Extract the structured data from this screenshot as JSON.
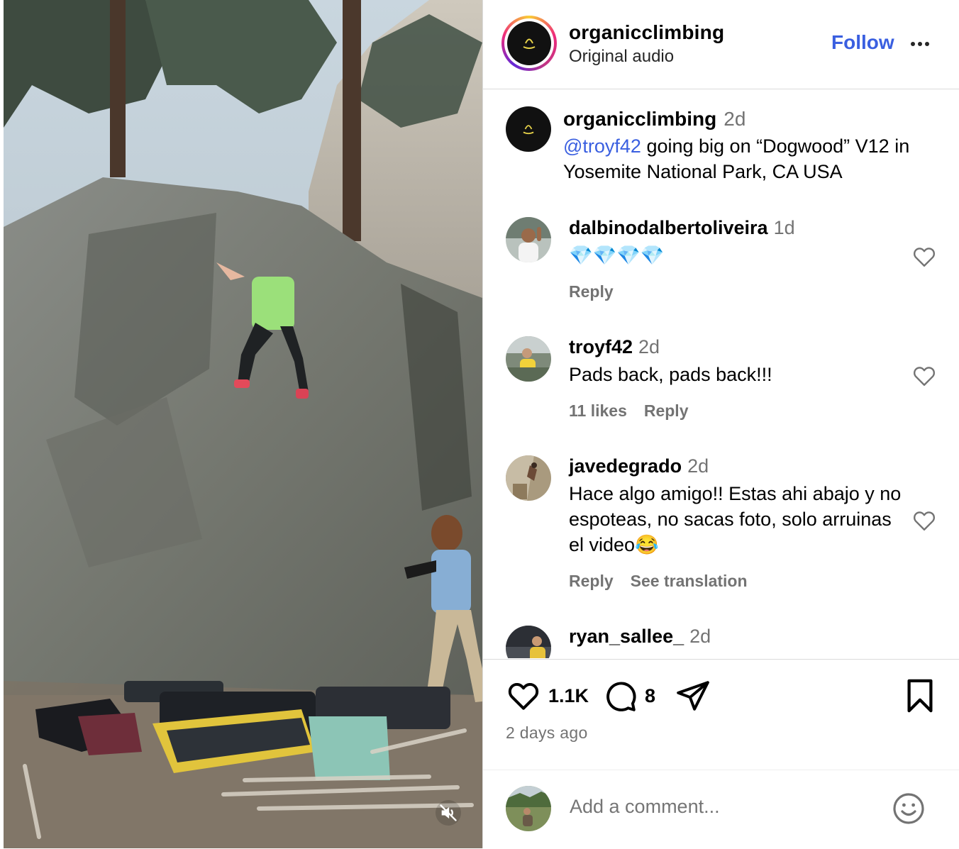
{
  "post": {
    "username": "organicclimbing",
    "audio": "Original audio",
    "follow_label": "Follow",
    "caption": {
      "username": "organicclimbing",
      "time": "2d",
      "mention": "@troyf42",
      "text": " going big on “Dogwood” V12 in Yosemite National Park, CA USA"
    }
  },
  "comments": [
    {
      "username": "dalbinodalbertoliveira",
      "time": "1d",
      "text": "💎💎💎💎",
      "likes": "",
      "reply": "Reply",
      "translation": ""
    },
    {
      "username": "troyf42",
      "time": "2d",
      "text": "Pads back, pads back!!!",
      "likes": "11 likes",
      "reply": "Reply",
      "translation": ""
    },
    {
      "username": "javedegrado",
      "time": "2d",
      "text": "Hace algo amigo!! Estas ahi abajo y no espoteas, no sacas foto, solo arruinas el video😂",
      "likes": "",
      "reply": "Reply",
      "translation": "See translation"
    },
    {
      "username": "ryan_sallee_",
      "time": "2d",
      "text": "",
      "likes": "",
      "reply": "",
      "translation": ""
    }
  ],
  "actions": {
    "likes_count": "1.1K",
    "comments_count": "8",
    "posted": "2 days ago"
  },
  "add_comment": {
    "placeholder": "Add a comment..."
  },
  "colors": {
    "link": "#3a5fe0",
    "muted": "#737373",
    "border": "#dbdbdb"
  },
  "icons": [
    "heart-icon",
    "comment-icon",
    "share-icon",
    "bookmark-icon",
    "more-icon",
    "emoji-icon",
    "muted-speaker-icon"
  ]
}
